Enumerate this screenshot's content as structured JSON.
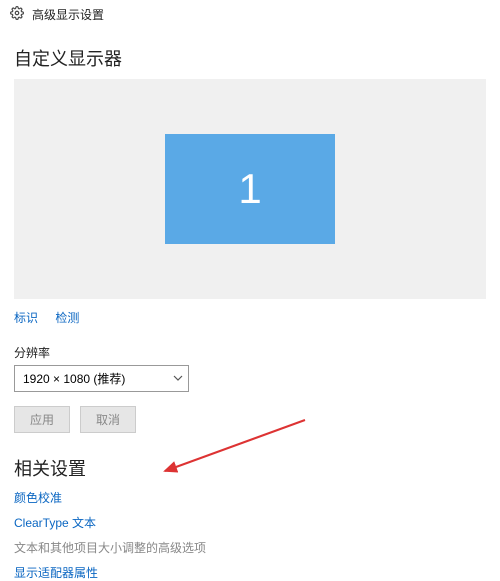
{
  "titlebar": {
    "title": "高级显示设置"
  },
  "sections": {
    "customize": "自定义显示器",
    "related": "相关设置"
  },
  "monitor": {
    "number": "1"
  },
  "links": {
    "identify": "标识",
    "detect": "检测"
  },
  "resolution": {
    "label": "分辨率",
    "selected": "1920 × 1080 (推荐)"
  },
  "buttons": {
    "apply": "应用",
    "cancel": "取消"
  },
  "related_links": {
    "color_cal": "颜色校准",
    "cleartype": "ClearType 文本",
    "text_sizing": "文本和其他项目大小调整的高级选项",
    "adapter_props": "显示适配器属性"
  }
}
